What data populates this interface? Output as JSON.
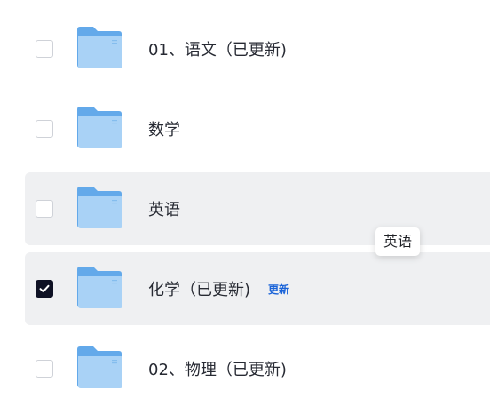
{
  "files": [
    {
      "name": "01、语文（已更新)",
      "checked": false,
      "badge": ""
    },
    {
      "name": "数学",
      "checked": false,
      "badge": ""
    },
    {
      "name": "英语",
      "checked": false,
      "badge": ""
    },
    {
      "name": "化学（已更新)",
      "checked": true,
      "badge": "更新"
    },
    {
      "name": "02、物理（已更新)",
      "checked": false,
      "badge": ""
    }
  ],
  "tooltip": {
    "text": "英语"
  },
  "colors": {
    "highlight_row": "#eff0f2",
    "checkbox_checked": "#0e1124",
    "badge": "#1a63d8",
    "folder_back": "#63a9ea",
    "folder_front": "#a9d2f6"
  },
  "icons": {
    "folder": "folder-icon",
    "checkbox": "checkbox-icon",
    "checkmark": "checkmark-icon"
  }
}
